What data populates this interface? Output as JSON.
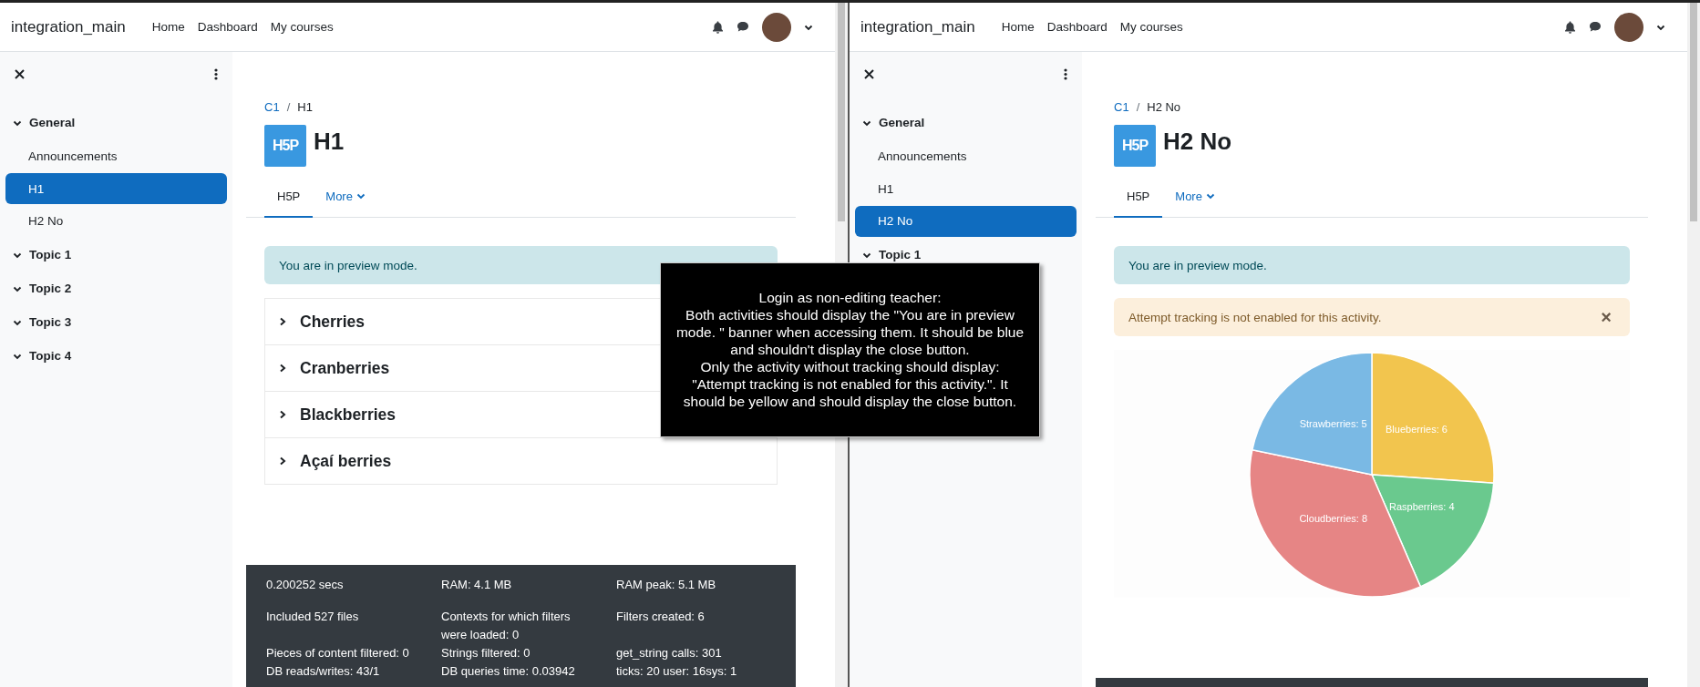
{
  "panes": [
    {
      "site_name": "integration_main",
      "nav": [
        "Home",
        "Dashboard",
        "My courses"
      ],
      "sidebar": {
        "sections": [
          {
            "title": "General",
            "items": [
              {
                "label": "Announcements",
                "selected": false
              },
              {
                "label": "H1",
                "selected": true
              },
              {
                "label": "H2 No",
                "selected": false
              }
            ]
          },
          {
            "title": "Topic 1"
          },
          {
            "title": "Topic 2"
          },
          {
            "title": "Topic 3"
          },
          {
            "title": "Topic 4"
          }
        ]
      },
      "breadcrumb": {
        "items": [
          "C1",
          "H1"
        ],
        "separator": "/"
      },
      "title": "H1",
      "icon_label": "H5P",
      "tabs": [
        {
          "label": "H5P",
          "selected": true,
          "kind": "tab"
        },
        {
          "label": "More",
          "selected": false,
          "kind": "menu"
        }
      ],
      "blocks": [
        {
          "kind": "info",
          "text": "You are in preview mode."
        },
        {
          "kind": "accordion",
          "items": [
            "Cherries",
            "Cranberries",
            "Blackberries",
            "Açaí berries"
          ]
        }
      ],
      "footer_stats": [
        [
          "0.200252 secs",
          "RAM: 4.1 MB",
          "RAM peak: 5.1 MB"
        ],
        [
          "Included 527 files",
          "Contexts for which filters were loaded: 0",
          "Filters created: 6"
        ],
        [
          "Pieces of content filtered: 0",
          "Strings filtered: 0",
          "get_string calls: 301"
        ],
        [
          "DB reads/writes: 43/1",
          "DB queries time: 0.03942",
          "ticks: 20 user: 16sys: 1"
        ]
      ]
    },
    {
      "site_name": "integration_main",
      "nav": [
        "Home",
        "Dashboard",
        "My courses"
      ],
      "sidebar": {
        "sections": [
          {
            "title": "General",
            "items": [
              {
                "label": "Announcements",
                "selected": false
              },
              {
                "label": "H1",
                "selected": false
              },
              {
                "label": "H2 No",
                "selected": true
              }
            ]
          },
          {
            "title": "Topic 1"
          }
        ]
      },
      "breadcrumb": {
        "items": [
          "C1",
          "H2 No"
        ],
        "separator": "/"
      },
      "title": "H2 No",
      "icon_label": "H5P",
      "tabs": [
        {
          "label": "H5P",
          "selected": true,
          "kind": "tab"
        },
        {
          "label": "More",
          "selected": false,
          "kind": "menu"
        }
      ],
      "blocks": [
        {
          "kind": "info",
          "text": "You are in preview mode."
        },
        {
          "kind": "warning",
          "text": "Attempt tracking is not enabled for this activity.",
          "close": "×"
        },
        {
          "kind": "chart",
          "chart_data": {
            "type": "pie",
            "categories": [
              "Blueberries",
              "Raspberries",
              "Cloudberries",
              "Strawberries"
            ],
            "values": [
              6,
              4,
              8,
              5
            ],
            "colors": [
              "#f2c54e",
              "#6ac98e",
              "#e68585",
              "#7ab9e4"
            ],
            "data_labels": true
          },
          "label_separator": ": "
        }
      ]
    }
  ],
  "tooltip": "Login as non-editing teacher:\nBoth activities should display the \"You are in preview mode. \" banner when accessing them. It should be blue and shouldn't display the close button.\nOnly the activity without tracking should display: \"Attempt tracking is not enabled for this activity.\". It should be yellow and should display the close button."
}
